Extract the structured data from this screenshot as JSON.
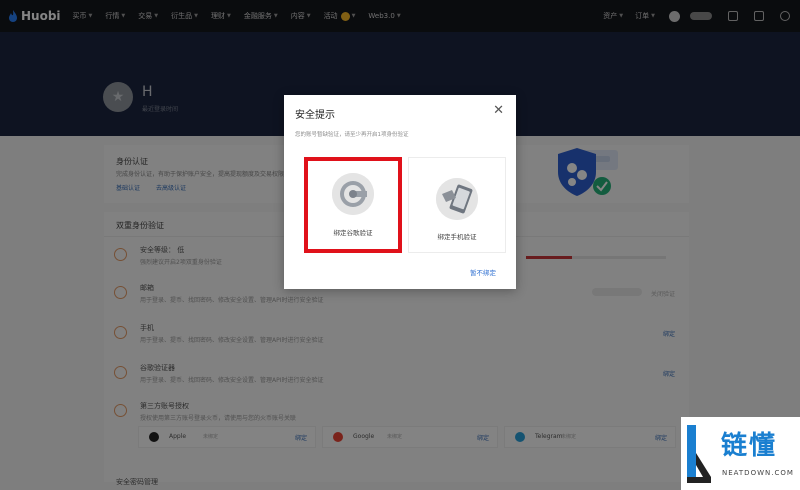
{
  "nav": {
    "logo": "Huobi",
    "items": [
      "买币",
      "行情",
      "交易",
      "衍生品",
      "理财",
      "金融服务",
      "内容",
      "活动",
      "Web3.0"
    ],
    "right_items": [
      "资产",
      "订单"
    ]
  },
  "hero": {
    "name": "H",
    "sub": "最近登录时间"
  },
  "kyc": {
    "title": "身份认证",
    "desc": "完成身份认证，有助于保护账户安全，提高提现额度及交易权限",
    "link_basic": "基础认证",
    "link_advanced": "去高级认证"
  },
  "two_fa": {
    "title": "双重身份验证",
    "rows": [
      {
        "title": "安全等级：  低",
        "desc": "强烈建议开启2项双重身份验证",
        "action": ""
      },
      {
        "title": "邮箱",
        "desc": "用于登录、提币、找回密码、修改安全设置、管理API时进行安全验证",
        "action": "关闭验证"
      },
      {
        "title": "手机",
        "desc": "用于登录、提币、找回密码、修改安全设置、管理API时进行安全验证",
        "action": "绑定"
      },
      {
        "title": "谷歌验证器",
        "desc": "用于登录、提币、找回密码、修改安全设置、管理API时进行安全验证",
        "action": "绑定"
      },
      {
        "title": "第三方账号授权",
        "desc": "授权使用第三方账号登录火币，请使用与您的火币账号关联",
        "action": ""
      }
    ],
    "third": [
      {
        "name": "Apple",
        "status": "未绑定",
        "action": "绑定"
      },
      {
        "name": "Google",
        "status": "未绑定",
        "action": "绑定"
      },
      {
        "name": "Telegram",
        "status": "未绑定",
        "action": "绑定"
      }
    ],
    "security_level": 0.33
  },
  "footer_title": "安全密码管理",
  "modal": {
    "title": "安全提示",
    "desc": "您的账号暂缺验证，请至少再开启1项身份验证",
    "option_google": "绑定谷歌验证",
    "option_phone": "绑定手机验证",
    "link": "暂不绑定",
    "highlight_color": "#e0111a"
  },
  "watermark": {
    "cn": "链懂",
    "en": "NEATDOWN.COM"
  }
}
